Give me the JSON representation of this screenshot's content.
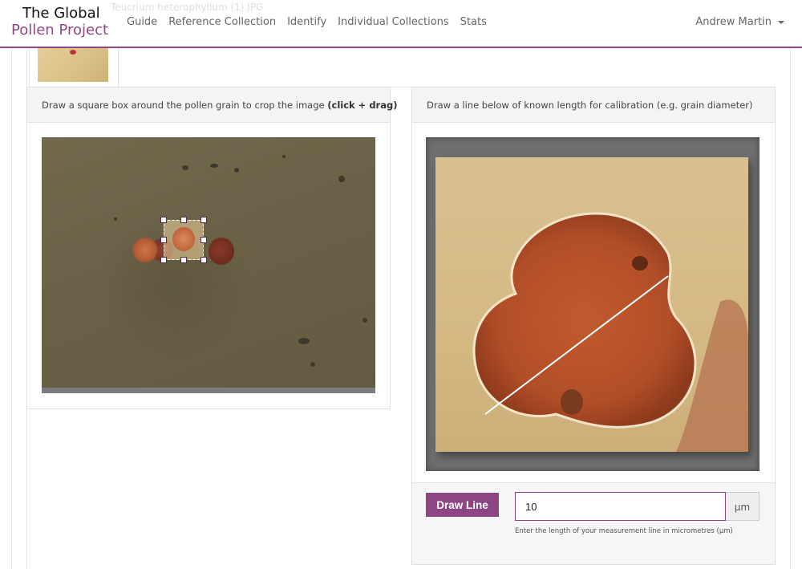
{
  "brand": {
    "line1": "The Global",
    "line2": "Pollen Project"
  },
  "ghost_title": "Teucrium heterophyllum (1).JPG",
  "nav": {
    "links": [
      "Guide",
      "Reference Collection",
      "Identify",
      "Individual Collections",
      "Stats"
    ]
  },
  "user": {
    "name": "Andrew Martin"
  },
  "crop_panel": {
    "heading": "Draw a square box around the pollen grain to crop the image",
    "heading_bold": "(click + drag)"
  },
  "calibration_panel": {
    "heading": "Draw a line below of known length for calibration (e.g. grain diameter)",
    "draw_button": "Draw Line",
    "length_value": "10",
    "unit": "µm",
    "help": "Enter the length of your measurement line in micrometres (µm)"
  },
  "colors": {
    "accent": "#8e4585"
  }
}
